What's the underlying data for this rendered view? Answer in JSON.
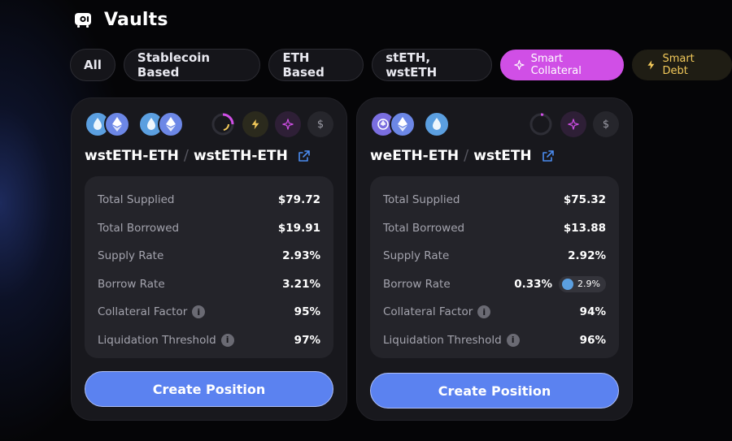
{
  "header": {
    "title": "Vaults"
  },
  "filters": [
    {
      "label": "All"
    },
    {
      "label": "Stablecoin Based"
    },
    {
      "label": "ETH Based"
    },
    {
      "label": "stETH, wstETH"
    },
    {
      "label": "Smart Collateral",
      "icon": "sparkle-icon",
      "active": true
    },
    {
      "label": "Smart Debt",
      "icon": "bolt-icon"
    }
  ],
  "colors": {
    "background": "#050507",
    "card": "#18181d",
    "panel": "#24242a",
    "accent_blue": "#5b82f0",
    "smart_collateral": "#d04fe6",
    "smart_debt": "#f2c95a"
  },
  "vaults": [
    {
      "supply_token": "wstETH-ETH",
      "borrow_token": "wstETH-ETH",
      "separator": "/",
      "stats": {
        "total_supplied_label": "Total Supplied",
        "total_supplied": "$79.72",
        "total_borrowed_label": "Total Borrowed",
        "total_borrowed": "$19.91",
        "supply_rate_label": "Supply Rate",
        "supply_rate": "2.93%",
        "borrow_rate_label": "Borrow Rate",
        "borrow_rate": "3.21%",
        "collateral_factor_label": "Collateral Factor",
        "collateral_factor": "95%",
        "liquidation_threshold_label": "Liquidation Threshold",
        "liquidation_threshold": "97%"
      },
      "cta": "Create Position"
    },
    {
      "supply_token": "weETH-ETH",
      "borrow_token": "wstETH",
      "separator": "/",
      "stats": {
        "total_supplied_label": "Total Supplied",
        "total_supplied": "$75.32",
        "total_borrowed_label": "Total Borrowed",
        "total_borrowed": "$13.88",
        "supply_rate_label": "Supply Rate",
        "supply_rate": "2.92%",
        "borrow_rate_label": "Borrow Rate",
        "borrow_rate": "0.33%",
        "borrow_reward": "2.9%",
        "collateral_factor_label": "Collateral Factor",
        "collateral_factor": "94%",
        "liquidation_threshold_label": "Liquidation Threshold",
        "liquidation_threshold": "96%"
      },
      "cta": "Create Position"
    }
  ],
  "icons": {
    "dollar": "$",
    "info": "i"
  }
}
